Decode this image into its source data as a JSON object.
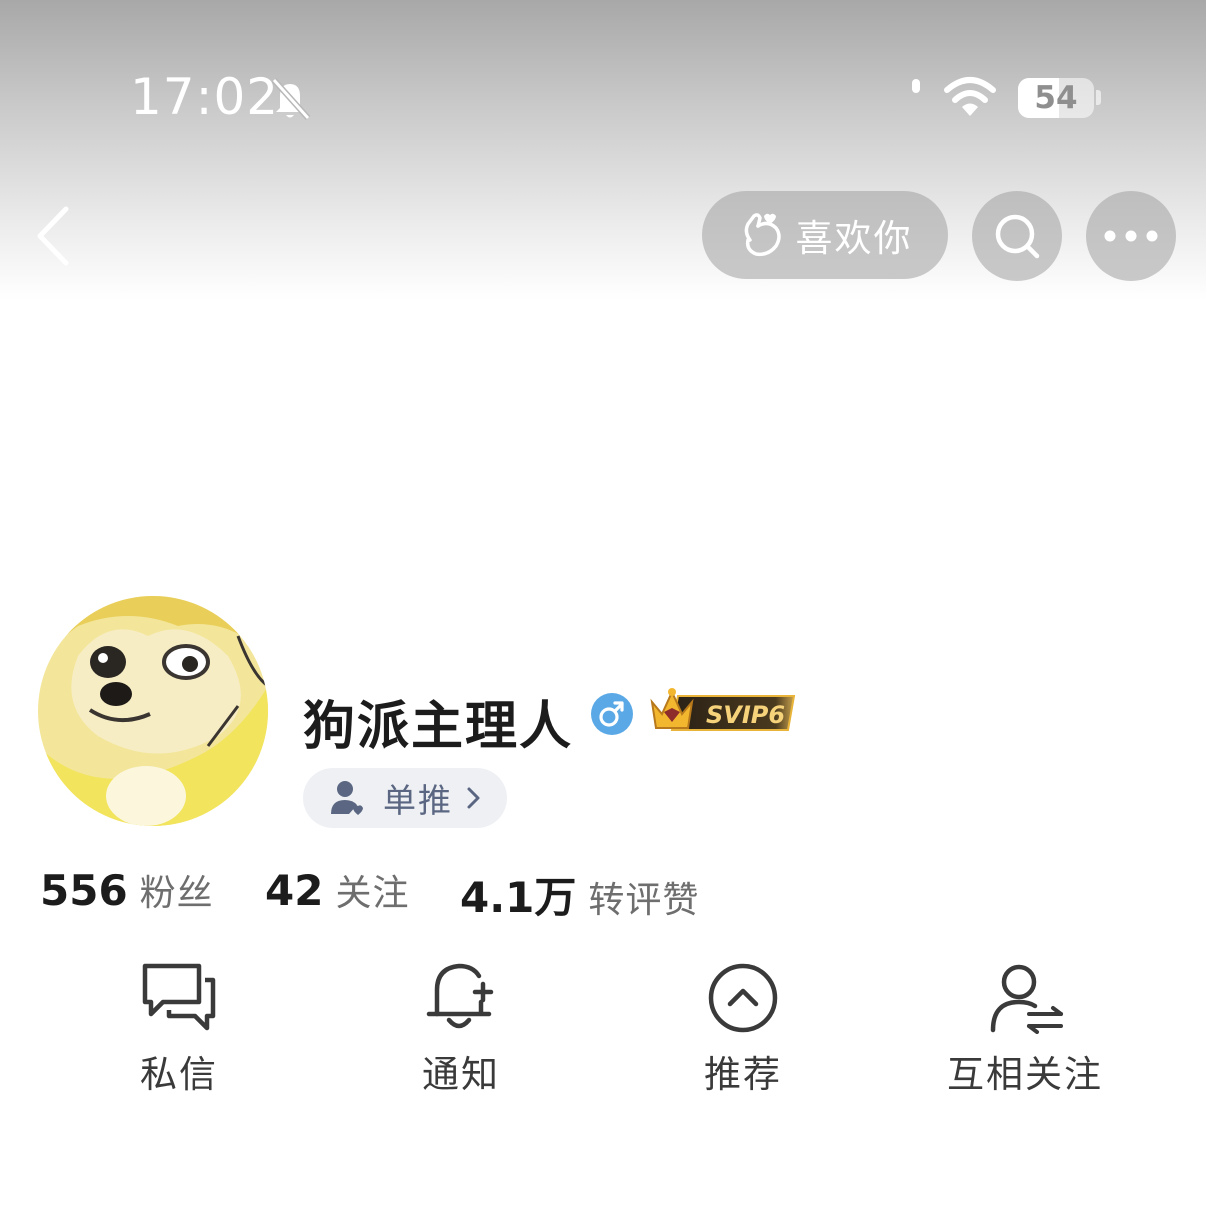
{
  "status_bar": {
    "time": "17:02",
    "battery_level": "54",
    "icons": [
      "bell-off-icon",
      "wifi-icon",
      "battery-icon"
    ]
  },
  "nav": {
    "back_icon": "chevron-left-icon",
    "like_label": "喜欢你",
    "like_icon": "heart-hand-icon",
    "search_icon": "search-icon",
    "more_icon": "more-icon"
  },
  "profile": {
    "username": "狗派主理人",
    "gender_icon": "male-icon",
    "vip_badge": "SVIP6",
    "tag_label": "单推",
    "tag_icon": "person-heart-icon"
  },
  "stats": [
    {
      "value": "556",
      "label": "粉丝"
    },
    {
      "value": "42",
      "label": "关注"
    },
    {
      "value": "4.1万",
      "label": "转评赞"
    }
  ],
  "actions": [
    {
      "label": "私信",
      "icon": "message-icon"
    },
    {
      "label": "通知",
      "icon": "bell-plus-icon"
    },
    {
      "label": "推荐",
      "icon": "recommend-icon"
    },
    {
      "label": "互相关注",
      "icon": "mutual-follow-icon"
    }
  ],
  "colors": {
    "accent_blue": "#5aa9e6",
    "tag_bg": "#eef0f4",
    "tag_text": "#5b6782",
    "vip_gold": "#f2b72e"
  }
}
